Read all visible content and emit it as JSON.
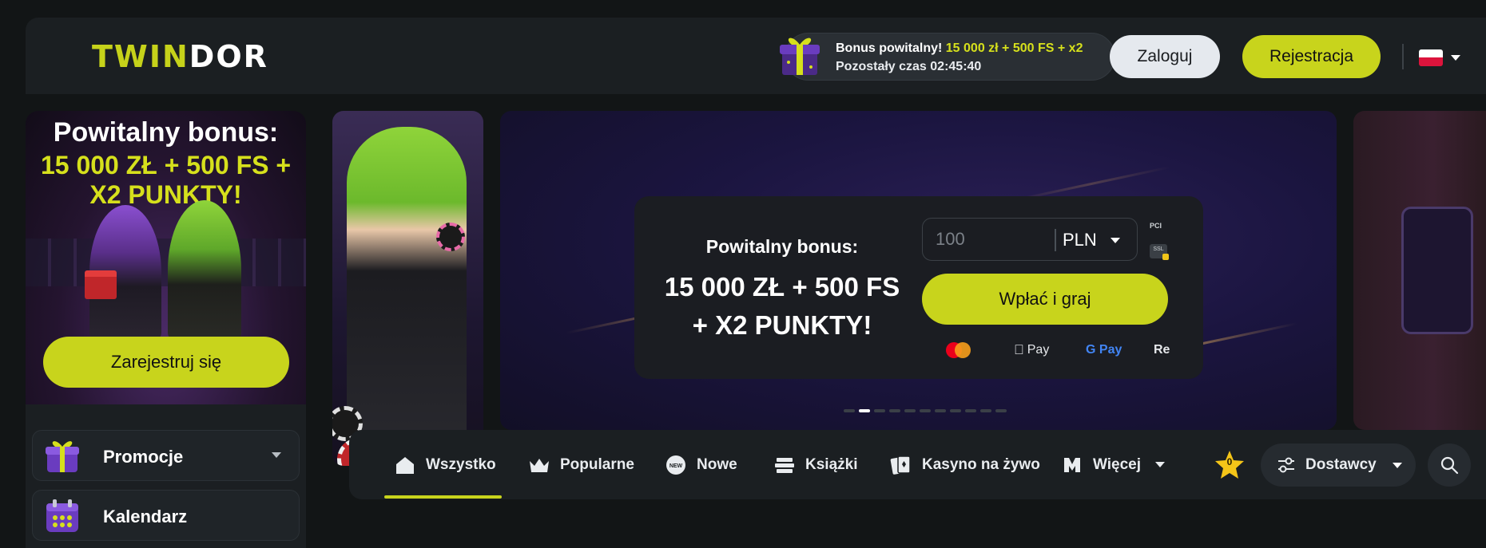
{
  "header": {
    "logo": {
      "part1": "TWI",
      "part2": "N",
      "part3": "DOR"
    },
    "bonus": {
      "label": "Bonus powitalny!",
      "value": "15 000 zł + 500 FS + x2",
      "timer_label": "Pozostały czas",
      "timer": "02:45:40"
    },
    "login_label": "Zaloguj",
    "register_label": "Rejestracja",
    "language": "pl",
    "flag_colors": [
      "#ffffff",
      "#dc143c"
    ]
  },
  "sidebar": {
    "promo": {
      "title": "Powitalny bonus:",
      "amount_line1": "15 000 ZŁ + 500 FS +",
      "amount_line2": "X2 PUNKTY!",
      "cta": "Zarejestruj się"
    },
    "items": [
      {
        "label": "Promocje",
        "icon": "gift-icon",
        "has_dropdown": true
      },
      {
        "label": "Kalendarz",
        "icon": "calendar-icon",
        "has_dropdown": false
      }
    ]
  },
  "hero": {
    "deposit": {
      "title": "Powitalny bonus:",
      "amount_line1": "15 000 ZŁ + 500 FS",
      "amount_line2": "+ X2 PUNKTY!",
      "amount_placeholder": "100",
      "currency": "PLN",
      "cta": "Wpłać i graj",
      "security_badges": [
        "PCI",
        "SSL"
      ],
      "payment_methods": [
        "mastercard",
        "Pay",
        "G Pay",
        "Re"
      ]
    },
    "slides_total": 11,
    "active_slide": 2
  },
  "categories": {
    "items": [
      {
        "label": "Wszystko",
        "icon": "home-icon",
        "active": true
      },
      {
        "label": "Popularne",
        "icon": "crown-icon"
      },
      {
        "label": "Nowe",
        "icon": "new-badge-icon"
      },
      {
        "label": "Książki",
        "icon": "books-icon"
      },
      {
        "label": "Kasyno na żywo",
        "icon": "cards-icon"
      },
      {
        "label": "Więcej",
        "icon": "more-icon"
      }
    ],
    "favorites_count": "0",
    "providers_label": "Dostawcy"
  },
  "colors": {
    "accent": "#c8d41c",
    "background": "#121516",
    "panel": "#1b1f22"
  }
}
